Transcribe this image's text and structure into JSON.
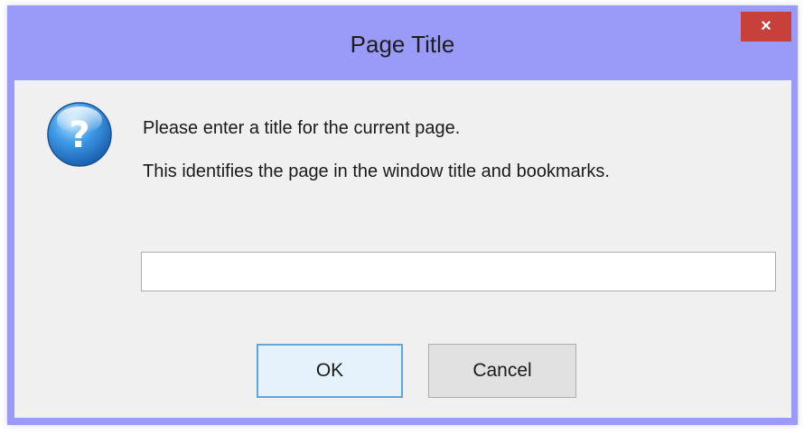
{
  "window": {
    "title": "Page Title",
    "close_glyph": "×"
  },
  "message": {
    "icon": "question-icon",
    "line1": "Please enter a title for the current page.",
    "line2": "This identifies the page in the window title and bookmarks."
  },
  "input": {
    "value": "",
    "placeholder": ""
  },
  "buttons": {
    "ok_label": "OK",
    "cancel_label": "Cancel"
  },
  "colors": {
    "frame": "#9a9af8",
    "close_button": "#c7403a",
    "client_bg": "#f0f0f0",
    "default_button_border": "#5fa6dd"
  }
}
